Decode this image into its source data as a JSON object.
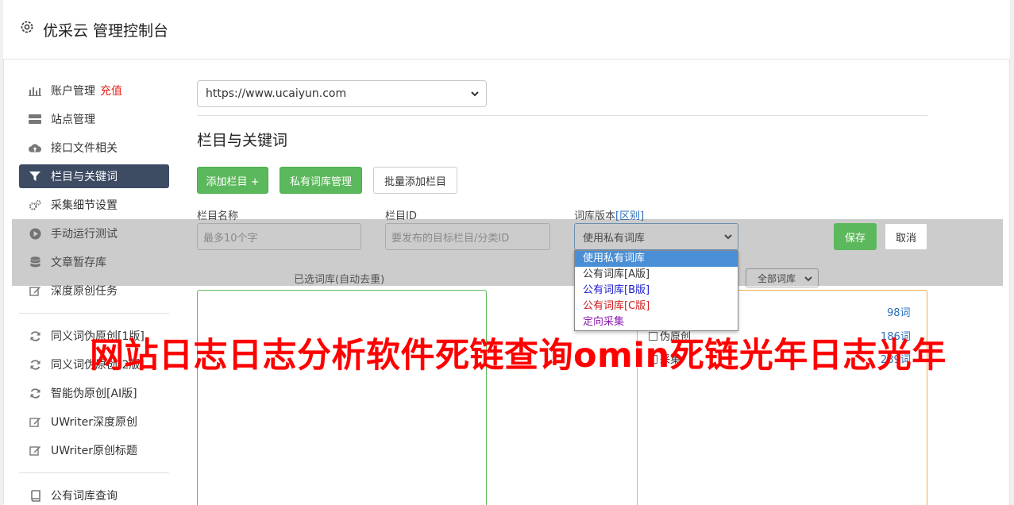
{
  "app": {
    "title": "优采云 管理控制台"
  },
  "sidebar": {
    "items": [
      {
        "label": "账户管理",
        "badge": "充值",
        "icon": "bar-chart-icon"
      },
      {
        "label": "站点管理",
        "icon": "server-icon"
      },
      {
        "label": "接口文件相关",
        "icon": "cloud-upload-icon"
      },
      {
        "label": "栏目与关键词",
        "icon": "filter-icon",
        "active": true
      },
      {
        "label": "采集细节设置",
        "icon": "cogs-icon"
      },
      {
        "label": "手动运行测试",
        "icon": "play-icon"
      },
      {
        "label": "文章暂存库",
        "icon": "database-icon"
      },
      {
        "label": "深度原创任务",
        "icon": "edit-icon"
      },
      {
        "label": "同义词伪原创[1版]",
        "icon": "refresh-icon"
      },
      {
        "label": "同义词伪原创[2版]",
        "icon": "refresh-icon"
      },
      {
        "label": "智能伪原创[AI版]",
        "icon": "refresh-icon"
      },
      {
        "label": "UWriter深度原创",
        "icon": "edit-icon"
      },
      {
        "label": "UWriter原创标题",
        "icon": "edit-icon"
      },
      {
        "label": "公有词库查询",
        "icon": "book-icon"
      }
    ]
  },
  "main": {
    "site_select": "https://www.ucaiyun.com",
    "section_title": "栏目与关键词",
    "buttons": {
      "add_column": "添加栏目 +",
      "private_lib": "私有词库管理",
      "batch_add": "批量添加栏目"
    },
    "form": {
      "name_label": "栏目名称",
      "name_placeholder": "最多10个字",
      "id_label": "栏目ID",
      "id_placeholder": "要发布的目标栏目/分类ID",
      "version_label": "词库版本",
      "version_link": "[区别]",
      "version_value": "使用私有词库",
      "save": "保存",
      "cancel": "取消"
    },
    "dropdown_options": [
      {
        "label": "使用私有词库",
        "color": "#ffffff"
      },
      {
        "label": "公有词库[A版]",
        "color": "#333333"
      },
      {
        "label": "公有词库[B版]",
        "color": "#1a1acc"
      },
      {
        "label": "公有词库[C版]",
        "color": "#cc1a1a"
      },
      {
        "label": "定向采集",
        "color": "#8b1ab0"
      }
    ],
    "selected_caption": "已选词库(自动去重)",
    "filter_select": "全部词库",
    "libraries": [
      {
        "name": "",
        "count": "98词"
      },
      {
        "name": "伪原创",
        "count": "186词"
      },
      {
        "name": "采集",
        "count": "289词"
      }
    ]
  },
  "watermark": "网站日志日志分析软件死链查询omin死链光年日志光年"
}
